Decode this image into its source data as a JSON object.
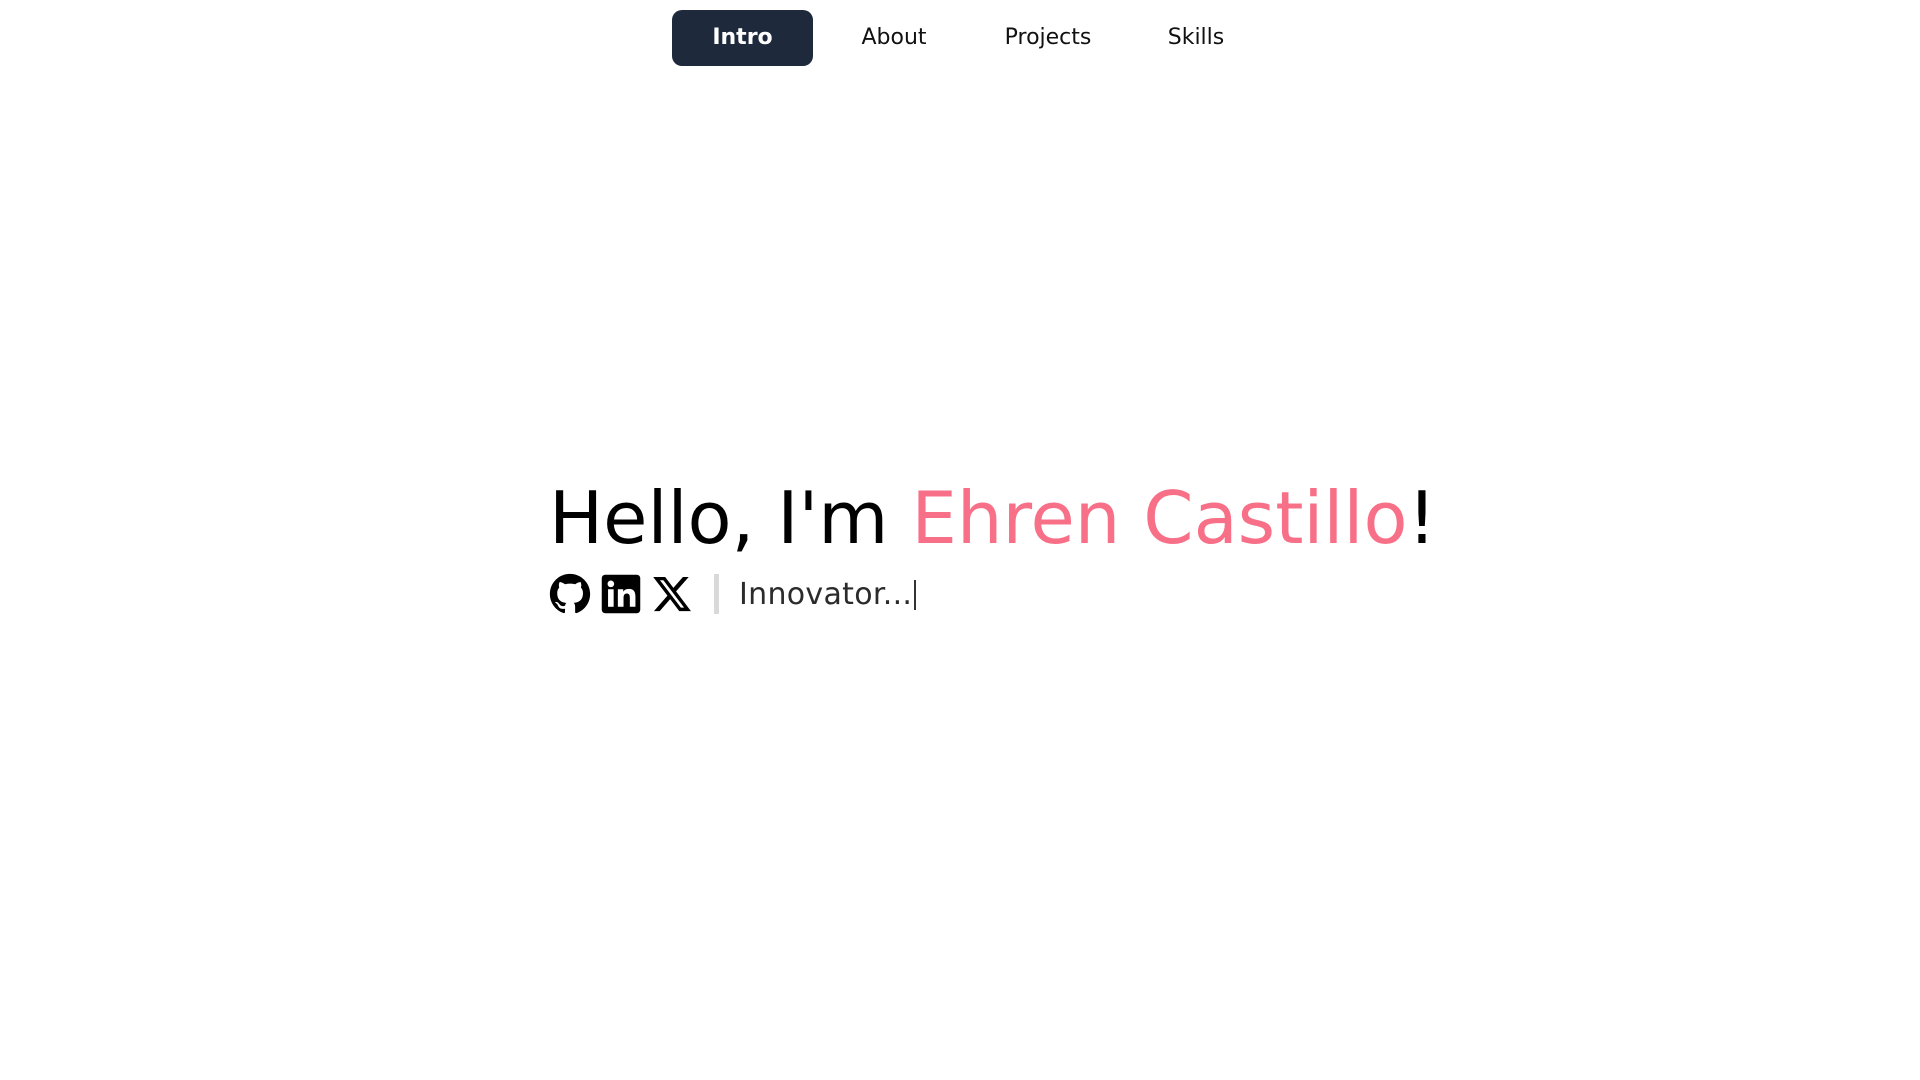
{
  "nav": {
    "items": [
      {
        "label": "Intro",
        "active": true
      },
      {
        "label": "About",
        "active": false
      },
      {
        "label": "Projects",
        "active": false
      },
      {
        "label": "Skills",
        "active": false
      }
    ],
    "active_color": "#1e293b"
  },
  "hero": {
    "greeting": "Hello, I'm ",
    "name": "Ehren Castillo",
    "exclamation": "!",
    "name_color": "#f87088",
    "role_text": "Innovator..."
  },
  "social": {
    "icons": [
      "github-icon",
      "linkedin-icon",
      "x-icon"
    ]
  }
}
